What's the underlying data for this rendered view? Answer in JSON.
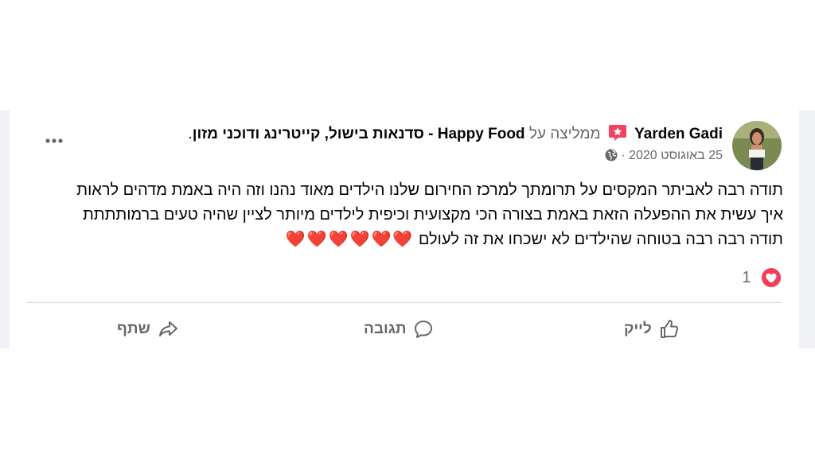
{
  "post": {
    "author": "Yarden Gadi",
    "recommends": "ממליצה על",
    "page_name": "Happy Food - סדנאות בישול, קייטרינג ודוכני מזון",
    "period": ".",
    "date": "25 באוגוסט 2020",
    "date_separator": "·",
    "text": "תודה רבה לאביתר המקסים על תרומתך למרכז החירום שלנו הילדים מאוד נהנו וזה היה באמת מדהים לראות איך עשית את ההפעלה הזאת באמת בצורה הכי מקצועית וכיפית לילדים מיותר לציין שהיה טעים ברמותתתת תודה רבה רבה בטוחה שהילדים לא ישכחו את זה לעולם",
    "hearts": "❤️❤️❤️❤️❤️❤️",
    "reaction_count": "1"
  },
  "actions": {
    "like": "לייק",
    "comment": "תגובה",
    "share": "שתף"
  },
  "colors": {
    "background": "#f0f2f5",
    "card": "#ffffff",
    "text": "#050505",
    "secondary": "#65676b",
    "recommend_badge": "#f3425f",
    "heart": "#f33e58"
  },
  "icons": [
    "avatar-photo",
    "recommend-star-icon",
    "globe-icon",
    "more-options-icon",
    "love-reaction-icon",
    "like-icon",
    "comment-icon",
    "share-icon"
  ]
}
